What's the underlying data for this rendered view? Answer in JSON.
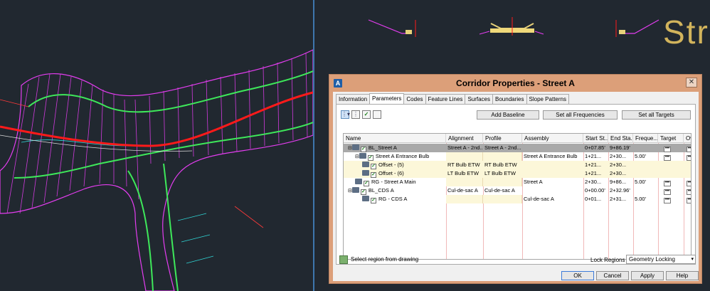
{
  "colors": {
    "canvas_bg": "#212830",
    "alignment_red": "#ff1a1a",
    "corridor_magenta": "#e43df0",
    "corridor_green": "#3ee85a",
    "corridor_cyan": "#2fd4d4",
    "dialog_title_bg": "#dc9f79",
    "street_text_gold": "#d2b45c"
  },
  "viewport_right": {
    "street_label": "Stre"
  },
  "dialog": {
    "title": "Corridor Properties - Street A",
    "close_symbol": "✕",
    "tabs": [
      "Information",
      "Parameters",
      "Codes",
      "Feature Lines",
      "Surfaces",
      "Boundaries",
      "Slope Patterns"
    ],
    "active_tab": "Parameters",
    "toolbar": {
      "add_baseline": "Add Baseline",
      "set_all_frequencies": "Set all Frequencies",
      "set_all_targets": "Set all Targets"
    },
    "columns": [
      "Name",
      "Alignment",
      "Profile",
      "Assembly",
      "Start St...",
      "End Sta...",
      "Freque...",
      "Target",
      "Ove"
    ],
    "rows": [
      {
        "name": "BL_Street A",
        "alignment": "Street A - 2nd...",
        "profile": "Street A - 2nd...",
        "assembly": "",
        "start": "0+07.85'",
        "end": "9+86.19'",
        "freq": "",
        "target": "•••",
        "override": "•••"
      },
      {
        "name": "Street A Entrance Bulb",
        "alignment": "",
        "profile": "",
        "assembly": "Street A Entrance Bulb",
        "start": "1+21...",
        "end": "2+30...",
        "freq": "5.00'",
        "target": "•••",
        "override": "•••"
      },
      {
        "name": "Offset - (5)",
        "alignment": "RT Bulb ETW",
        "profile": "RT Bulb ETW",
        "assembly": "",
        "start": "1+21...",
        "end": "2+30...",
        "freq": "",
        "target": "",
        "override": ""
      },
      {
        "name": "Offset - (6)",
        "alignment": "LT Bulb ETW",
        "profile": "LT Bulb ETW",
        "assembly": "",
        "start": "1+21...",
        "end": "2+30...",
        "freq": "",
        "target": "",
        "override": ""
      },
      {
        "name": "RG - Street A Main",
        "alignment": "",
        "profile": "",
        "assembly": "Street A",
        "start": "2+30...",
        "end": "9+86...",
        "freq": "5.00'",
        "target": "•••",
        "override": "•••"
      },
      {
        "name": "BL_CDS A",
        "alignment": "Cul-de-sac A",
        "profile": "Cul-de-sac A",
        "assembly": "",
        "start": "0+00.00'",
        "end": "2+32.96'",
        "freq": "",
        "target": "•••",
        "override": "•••"
      },
      {
        "name": "RG - CDS A",
        "alignment": "",
        "profile": "",
        "assembly": "Cul-de-sac A",
        "start": "0+01...",
        "end": "2+31...",
        "freq": "5.00'",
        "target": "•••",
        "override": "•••"
      }
    ],
    "select_region_label": "Select region from drawing",
    "lock_regions_label": "Lock Regions To:",
    "lock_regions_value": "Geometry Locking",
    "buttons": {
      "ok": "OK",
      "cancel": "Cancel",
      "apply": "Apply",
      "help": "Help"
    }
  }
}
